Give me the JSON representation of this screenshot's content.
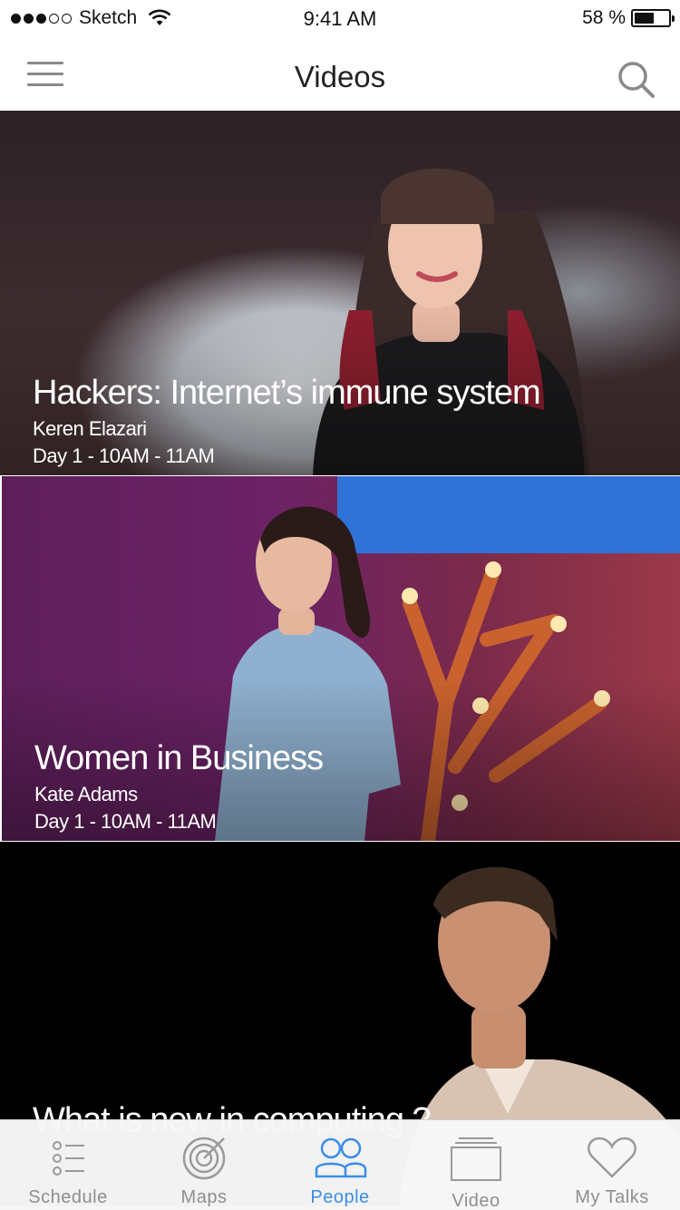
{
  "status_bar": {
    "carrier": "Sketch",
    "time": "9:41 AM",
    "battery_text": "58 %",
    "battery_level": 0.58
  },
  "nav": {
    "title": "Videos"
  },
  "videos": [
    {
      "title": "Hackers: Internet’s immune system",
      "speaker": "Keren Elazari",
      "time": "Day 1 - 10AM - 11AM"
    },
    {
      "title": "Women in Business",
      "speaker": "Kate Adams",
      "time": "Day 1 - 10AM - 11AM"
    },
    {
      "title": "What is new in computing ?"
    }
  ],
  "tabs": [
    {
      "label": "Schedule",
      "icon": "list-icon",
      "active": false
    },
    {
      "label": "Maps",
      "icon": "target-icon",
      "active": false
    },
    {
      "label": "People",
      "icon": "people-icon",
      "active": true
    },
    {
      "label": "Video",
      "icon": "video-icon",
      "active": false
    },
    {
      "label": "My Talks",
      "icon": "heart-icon",
      "active": false
    }
  ],
  "colors": {
    "accent": "#3a8ee6",
    "tab_inactive": "#8e8e8e",
    "nav_icon": "#8a8a8a"
  }
}
